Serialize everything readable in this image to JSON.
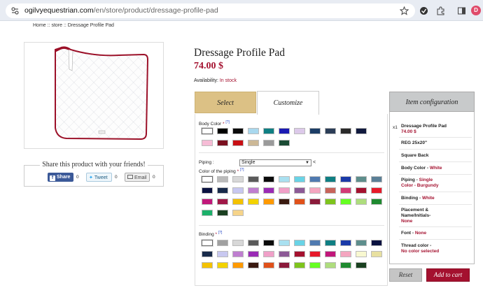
{
  "browser": {
    "url_host": "ogilvyequestrian.com",
    "url_path": "/en/store/product/dressage-profile-pad",
    "avatar_letter": "D"
  },
  "breadcrumb": "Home :: store :: Dressage Profile Pad",
  "product": {
    "title": "Dressage Profile Pad",
    "price": "74.00 $",
    "availability_label": "Availability:",
    "availability_value": "In stock"
  },
  "share": {
    "title": "Share this product with your friends!",
    "buttons": [
      {
        "label": "Share",
        "count": "0"
      },
      {
        "label": "Tweet",
        "count": "0"
      },
      {
        "label": "Email",
        "count": "0"
      }
    ]
  },
  "tabs": [
    {
      "label": "Select"
    },
    {
      "label": "Customize"
    }
  ],
  "options": {
    "body_color_label": "Body Color",
    "required_mark": "*",
    "info_mark": "[?]",
    "body_colors": [
      "#ffffff",
      "#000000",
      "#0b0b0b",
      "#a9d8ee",
      "#0f7f83",
      "#1b1ab3",
      "#dcc9ea",
      "#1c3d66",
      "#2b3d57",
      "#2a2a2a",
      "#111a3e",
      "#f6bcd6",
      "#7a0f1f",
      "#c80f14",
      "#ccb896",
      "#9a9a9a",
      "#1a4b34"
    ],
    "piping_label": "Piping :",
    "piping_value": "Single",
    "piping_after": "<",
    "piping_color_label": "Color of the piping",
    "piping_colors": [
      "#ffffff",
      "#bbbbbb",
      "#d8d8d8",
      "#5a5a5a",
      "#0b0b0b",
      "#a9e0f0",
      "#69d3e6",
      "#4f7ab0",
      "#0f7f83",
      "#1a3aa8",
      "#5e8e8c",
      "#5a7f96",
      "#0a1240",
      "#182a4a",
      "#c8c8f0",
      "#bf7fd0",
      "#9a2bb5",
      "#f0a0c8",
      "#8c5a96",
      "#f4a6c0",
      "#c8645a",
      "#d23a78",
      "#a4112f",
      "#e7192a",
      "#c1177a",
      "#a01848",
      "#f4c200",
      "#f3d300",
      "#ff9a00",
      "#3a1a10",
      "#e0511a",
      "#8a1a3a",
      "#7ec41d",
      "#66ff22",
      "#aedd7d",
      "#1f8a30",
      "#1cb06a",
      "#1a4020",
      "#f6d48a"
    ],
    "binding_label": "Binding",
    "binding_colors": [
      "#ffffff",
      "#a0a0a0",
      "#d8d8d8",
      "#5a5a5a",
      "#0b0b0b",
      "#a9e0f0",
      "#69d3e6",
      "#4f7ab0",
      "#0f7f83",
      "#1a3aa8",
      "#5e8e8c",
      "#0a1240",
      "#182a4a",
      "#c8c8f0",
      "#bf7fd0",
      "#9a2bb5",
      "#f0a0c8",
      "#8c5a96",
      "#a4112f",
      "#e7192a",
      "#c1177a",
      "#f4a6c0",
      "#f8f8d0",
      "#e8e0a0",
      "#f4c200",
      "#f3d300",
      "#ff9a00",
      "#3a1a10",
      "#e0511a",
      "#8a1a3a",
      "#7ec41d",
      "#66ff22",
      "#aedd7d",
      "#1f8a30",
      "#1a4020"
    ]
  },
  "config": {
    "header": "Item configuration",
    "qty": "x1",
    "product_name": "Dressage Profile Pad",
    "product_price": "74.00 $",
    "size": "REG 25x20\"",
    "back": "Square Back",
    "body_color_k": "Body Color - ",
    "body_color_v": "White",
    "piping_k": "Piping - ",
    "piping_v1": "Single",
    "piping_v2": "Color - Burgundy",
    "binding_k": "Binding - ",
    "binding_v": "White",
    "placement_k1": "Placement &",
    "placement_k2": "Name/Initials-",
    "placement_v": "None",
    "font_k": "Font - ",
    "font_v": "None",
    "thread_k": "Thread color -",
    "thread_v": "No color selected"
  },
  "actions": {
    "reset": "Reset",
    "add_to_cart": "Add to cart"
  },
  "colors": {
    "brand_red": "#a4112f",
    "tab_gold": "#dcc185",
    "config_gray": "#c8cacb"
  }
}
